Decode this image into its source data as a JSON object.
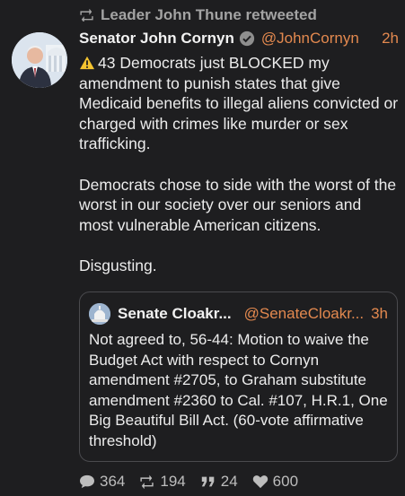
{
  "retweet_header": "Leader John Thune retweeted",
  "tweet": {
    "author_name": "Senator John Cornyn",
    "handle": "@JohnCornyn",
    "time": "2h",
    "paragraph1": "43 Democrats just BLOCKED my amendment to punish states that give Medicaid benefits to illegal aliens convicted or charged with crimes like murder or sex trafficking.",
    "paragraph2": "Democrats chose to side with the worst of the worst in our society over our seniors and most vulnerable American citizens.",
    "paragraph3": "Disgusting."
  },
  "quote": {
    "author_name": "Senate Cloakr...",
    "handle": "@SenateCloakr...",
    "time": "3h",
    "text": "Not agreed to, 56-44: Motion to waive the Budget Act with respect to Cornyn amendment #2705, to Graham substitute amendment #2360 to Cal. #107, H.R.1, One Big Beautiful Bill Act. (60-vote affirmative threshold)"
  },
  "actions": {
    "replies": "364",
    "retweets": "194",
    "quotes": "24",
    "likes": "600"
  },
  "colors": {
    "background": "#1e1e20",
    "accent": "#e3894f",
    "muted": "#a3a3a3"
  },
  "icons": [
    "retweet-icon",
    "verified-badge-icon",
    "warning-icon",
    "reply-icon",
    "quote-icon",
    "heart-icon"
  ]
}
